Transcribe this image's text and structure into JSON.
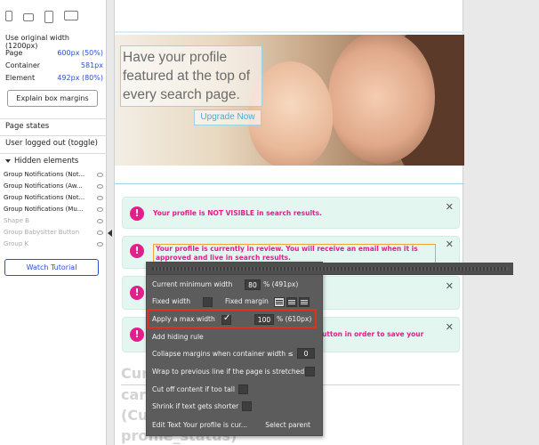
{
  "sidebar": {
    "devices": [
      "mobile-icon",
      "tablet-landscape-icon",
      "tablet-icon",
      "laptop-icon"
    ],
    "use_original_width": "Use original width (1200px)",
    "page_label": "Page",
    "page_value": "600px (50%)",
    "container_label": "Container",
    "container_value": "581px",
    "element_label": "Element",
    "element_value": "492px (80%)",
    "explain_button": "Explain box margins",
    "page_states_title": "Page states",
    "page_state_item": "User logged out (toggle)",
    "hidden_elements_title": "Hidden elements",
    "hidden_items": [
      {
        "label": "Group Notifications (Not...",
        "dim": false
      },
      {
        "label": "Group Notifications (Aw...",
        "dim": false
      },
      {
        "label": "Group Notifications (Not...",
        "dim": false
      },
      {
        "label": "Group Notifications (Mu...",
        "dim": false
      },
      {
        "label": "Shape B",
        "dim": true
      },
      {
        "label": "Group Babysitter Button",
        "dim": true
      },
      {
        "label": "Group K",
        "dim": true
      }
    ],
    "watch_tutorial": "Watch Tutorial"
  },
  "canvas": {
    "hero_text": "Have your profile featured at the top of every search page.",
    "upgrade_button": "Upgrade Now",
    "alerts": [
      {
        "text": "Your profile is NOT VISIBLE in search results.",
        "selected": false
      },
      {
        "text": "Your profile is currently in review. You will receive an email when it is approved and live in search results.",
        "selected": true
      },
      {
        "text": "",
        "selected": false
      },
      {
        "text": "utton in order to save your",
        "selected": false
      }
    ],
    "bg_heading_lines": [
      "Cur",
      "care",
      "(Cu",
      "profile_status)"
    ]
  },
  "popup": {
    "current_min_width_label": "Current minimum width",
    "current_min_width_value": "80",
    "current_min_width_unit": "% (491px)",
    "fixed_width_label": "Fixed width",
    "fixed_margin_label": "Fixed margin",
    "max_width_label": "Apply a max width",
    "max_width_value": "100",
    "max_width_unit": "% (610px)",
    "add_hiding_rule": "Add hiding rule",
    "collapse_margins_label": "Collapse margins when container width ≤",
    "collapse_margins_value": "0",
    "wrap_label": "Wrap to previous line if the page is stretched",
    "cut_off_label": "Cut off content if too tall",
    "shrink_label": "Shrink if text gets shorter",
    "footer_left": "Edit Text Your profile is cur...",
    "footer_right": "Select parent"
  }
}
